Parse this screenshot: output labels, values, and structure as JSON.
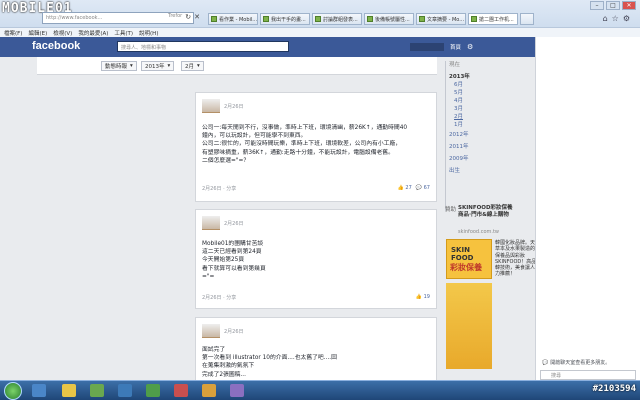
{
  "browser": {
    "watermark": "MOBILE01",
    "address_text": "http://www.facebook...",
    "search_hint": "Trefor",
    "tabs": [
      {
        "label": "看作業 - Mobil..."
      },
      {
        "label": "我出干手的畫..."
      },
      {
        "label": "討論群組發表..."
      },
      {
        "label": "後備帳號屬性..."
      },
      {
        "label": "文章摘要 - Mo..."
      },
      {
        "label": "搶二團工作机..."
      },
      {
        "label": ""
      }
    ],
    "menu": [
      "檔案(F)",
      "編輯(E)",
      "檢視(V)",
      "我的最愛(A)",
      "工具(T)",
      "說明(H)"
    ]
  },
  "fb": {
    "logo": "facebook",
    "search_placeholder": "搜尋人、地標和事物",
    "nav_home": "首頁",
    "filters": {
      "highlights": "動態時報",
      "year": "2013年",
      "month": "2月"
    },
    "posts": [
      {
        "date": "2月26日",
        "lines": [
          "公司一:每天閒到不行，沒事做，準時上下班，環境清幽，薪26K↑，通勤時間40",
          "鐘內，可以玩設計，但可能學不到東西。",
          "公司二:很忙的，可能沒時間玩樂，準時上下班，環境軟差，公司內有小工廠，",
          "有塑膠味摘重，薪36K↑，通勤:走路十分鐘，不能玩設計，電腦設備老舊。",
          "",
          "二個怎麼選=\"=？"
        ],
        "meta": "2月26日 · 分享",
        "likes": "27",
        "comments": "67"
      },
      {
        "date": "2月26日",
        "lines": [
          "Mobile01的團購甘苦談",
          "這二天已經看到第24頁",
          "今天開始第25頁",
          "看下就算可以看到第幾頁",
          "=\"="
        ],
        "meta": "2月26日 · 分享",
        "likes": "19"
      },
      {
        "date": "2月26日",
        "lines": [
          "面試完了",
          "第一次看到 illustrator 10的介面....也太舊了吧....囧",
          "在蒐集刺激的氣氛下",
          "完成了2張圖稿..."
        ]
      }
    ],
    "timeline_years": {
      "header": "現在",
      "current_year": "2013年",
      "months": [
        "6月",
        "5月",
        "4月",
        "3月",
        "2月",
        "1月"
      ],
      "older_years": [
        "2012年",
        "2011年",
        "2009年",
        "出生"
      ]
    },
    "ad": {
      "header": "贊助",
      "title": "SKINFOOD彩妝保養商品·門市&線上購物",
      "url": "skinfood.com.tw",
      "image_line1": "SKIN FOOD",
      "image_line2": "彩妝保養",
      "text": "韓國化妝品牌。天然\n草本及水果製造的\n保養品與彩妝\nSKINFOOD！高品質日\n韓技術，美食讓人保\n力推薦！"
    },
    "chat": {
      "message": "開啟聊天室查看更多朋友。",
      "search_placeholder": "搜尋"
    }
  },
  "taskbar": {
    "post_id": "#2103594"
  }
}
